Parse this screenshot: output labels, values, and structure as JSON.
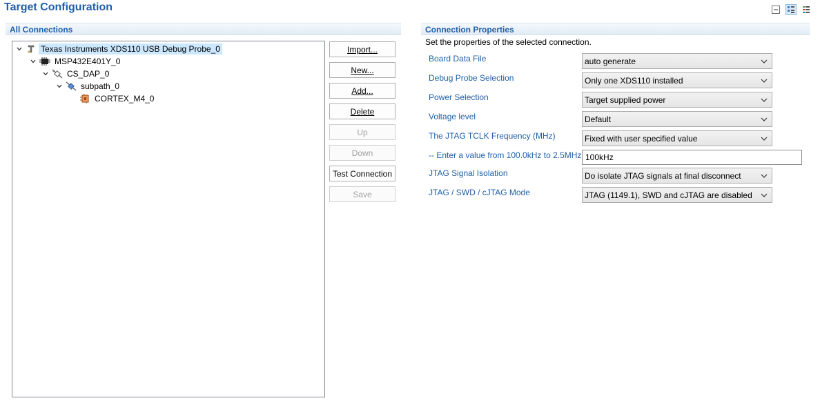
{
  "page": {
    "title": "Target Configuration"
  },
  "toolbar": {
    "icons": [
      "collapse-all-icon",
      "basic-view-icon",
      "advanced-view-icon"
    ]
  },
  "left_panel": {
    "header": "All Connections",
    "tree": [
      {
        "label": "Texas Instruments XDS110 USB Debug Probe_0",
        "icon": "debug-probe-icon",
        "level": 0,
        "expanded": true,
        "selected": true
      },
      {
        "label": "MSP432E401Y_0",
        "icon": "chip-icon",
        "level": 1,
        "expanded": true
      },
      {
        "label": "CS_DAP_0",
        "icon": "dap-icon",
        "level": 2,
        "expanded": true
      },
      {
        "label": "subpath_0",
        "icon": "subpath-icon",
        "level": 3,
        "expanded": true
      },
      {
        "label": "CORTEX_M4_0",
        "icon": "cpu-core-icon",
        "level": 4
      }
    ],
    "buttons": {
      "import": "Import...",
      "new": "New...",
      "add": "Add...",
      "delete": "Delete",
      "up": "Up",
      "down": "Down",
      "test_connection": "Test Connection",
      "save": "Save"
    }
  },
  "right_panel": {
    "header": "Connection Properties",
    "subtitle": "Set the properties of the selected connection.",
    "properties": {
      "board_data_file": {
        "label": "Board Data File",
        "value": "auto generate"
      },
      "debug_probe_selection": {
        "label": "Debug Probe Selection",
        "value": "Only one XDS110 installed"
      },
      "power_selection": {
        "label": "Power Selection",
        "value": "Target supplied power"
      },
      "voltage_level": {
        "label": "Voltage level",
        "value": "Default"
      },
      "jtag_tclk_frequency": {
        "label": "The JTAG TCLK Frequency (MHz)",
        "value": "Fixed with user specified value"
      },
      "tclk_value": {
        "label": "-- Enter a value from 100.0kHz to 2.5MHz",
        "value": "100kHz"
      },
      "jtag_signal_isolation": {
        "label": "JTAG Signal Isolation",
        "value": "Do isolate JTAG signals at final disconnect"
      },
      "jtag_mode": {
        "label": "JTAG / SWD / cJTAG Mode",
        "value": "JTAG (1149.1), SWD and cJTAG are disabled"
      }
    }
  },
  "colors": {
    "title": "#1f5fa8",
    "selection": "#cce8ff",
    "label_blue": "#1f5fa8"
  }
}
